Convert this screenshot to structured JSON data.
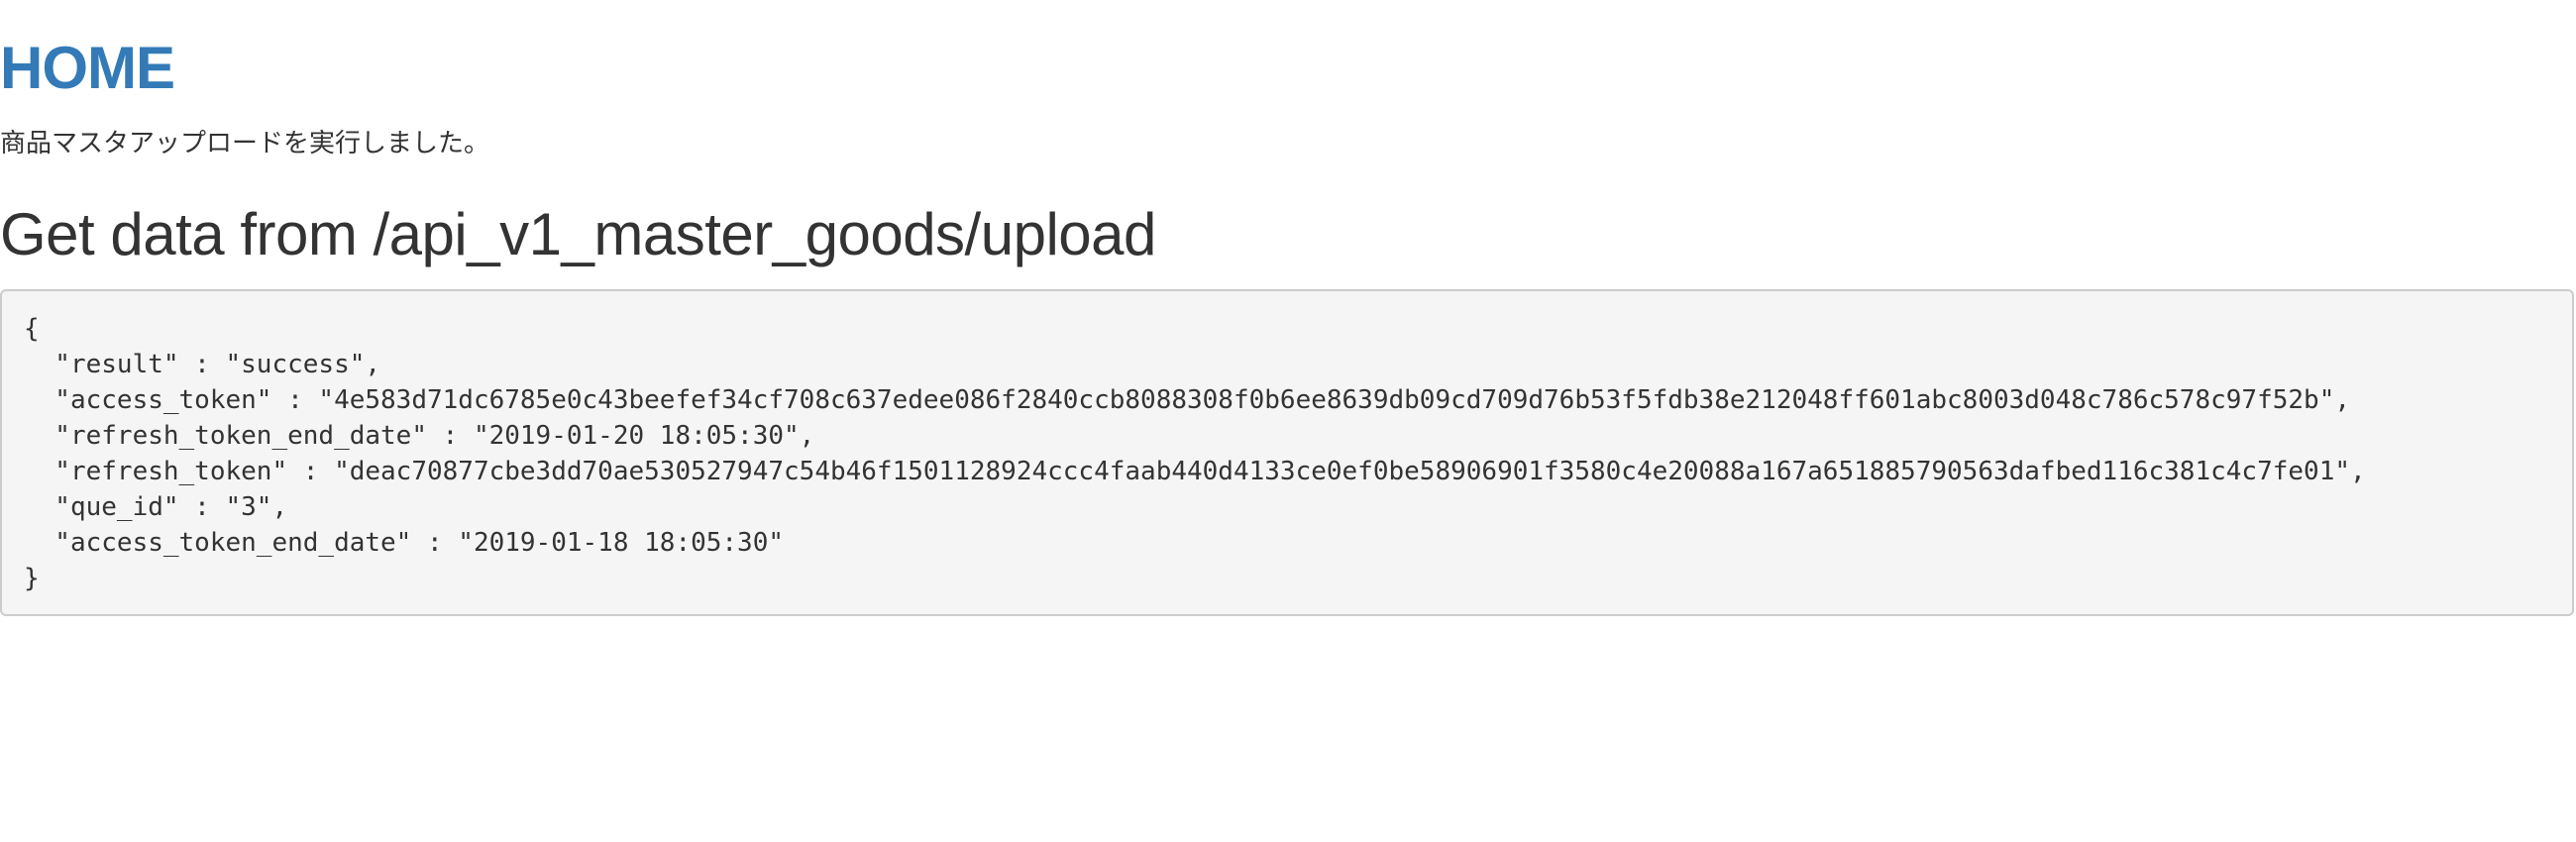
{
  "header": {
    "home_label": "HOME"
  },
  "status": {
    "message": "商品マスタアップロードを実行しました。"
  },
  "api_section": {
    "title": "Get data from /api_v1_master_goods/upload"
  },
  "response": {
    "open_brace": "{",
    "lines": [
      "  \"result\" : \"success\",",
      "  \"access_token\" : \"4e583d71dc6785e0c43beefef34cf708c637edee086f2840ccb8088308f0b6ee8639db09cd709d76b53f5fdb38e212048ff601abc8003d048c786c578c97f52b\",",
      "  \"refresh_token_end_date\" : \"2019-01-20 18:05:30\",",
      "  \"refresh_token\" : \"deac70877cbe3dd70ae530527947c54b46f1501128924ccc4faab440d4133ce0ef0be58906901f3580c4e20088a167a651885790563dafbed116c381c4c7fe01\",",
      "  \"que_id\" : \"3\",",
      "  \"access_token_end_date\" : \"2019-01-18 18:05:30\""
    ],
    "close_brace": "}"
  }
}
